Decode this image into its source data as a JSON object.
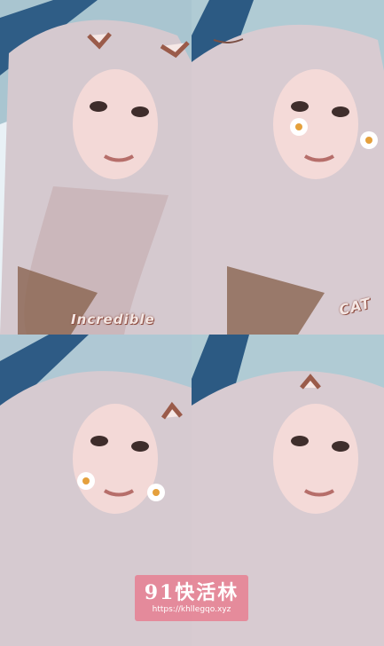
{
  "image": {
    "layout": "2x2 grid of selfie photos",
    "stickers": {
      "incredible_text": "Incredible",
      "cat_text": "CAT"
    },
    "watermark": {
      "title": "91快活林",
      "url": "https://khllegqo.xyz"
    },
    "colors": {
      "sky": "#e8f0f5",
      "foliage": "#7fa9b8",
      "hair": "#d8c6cc",
      "skin": "#f4d8d6",
      "watermark_bg": "#e8788c"
    },
    "icons": [
      "flower-sticker-icon",
      "cat-ear-sticker-icon",
      "sparkle-line-icon"
    ]
  }
}
